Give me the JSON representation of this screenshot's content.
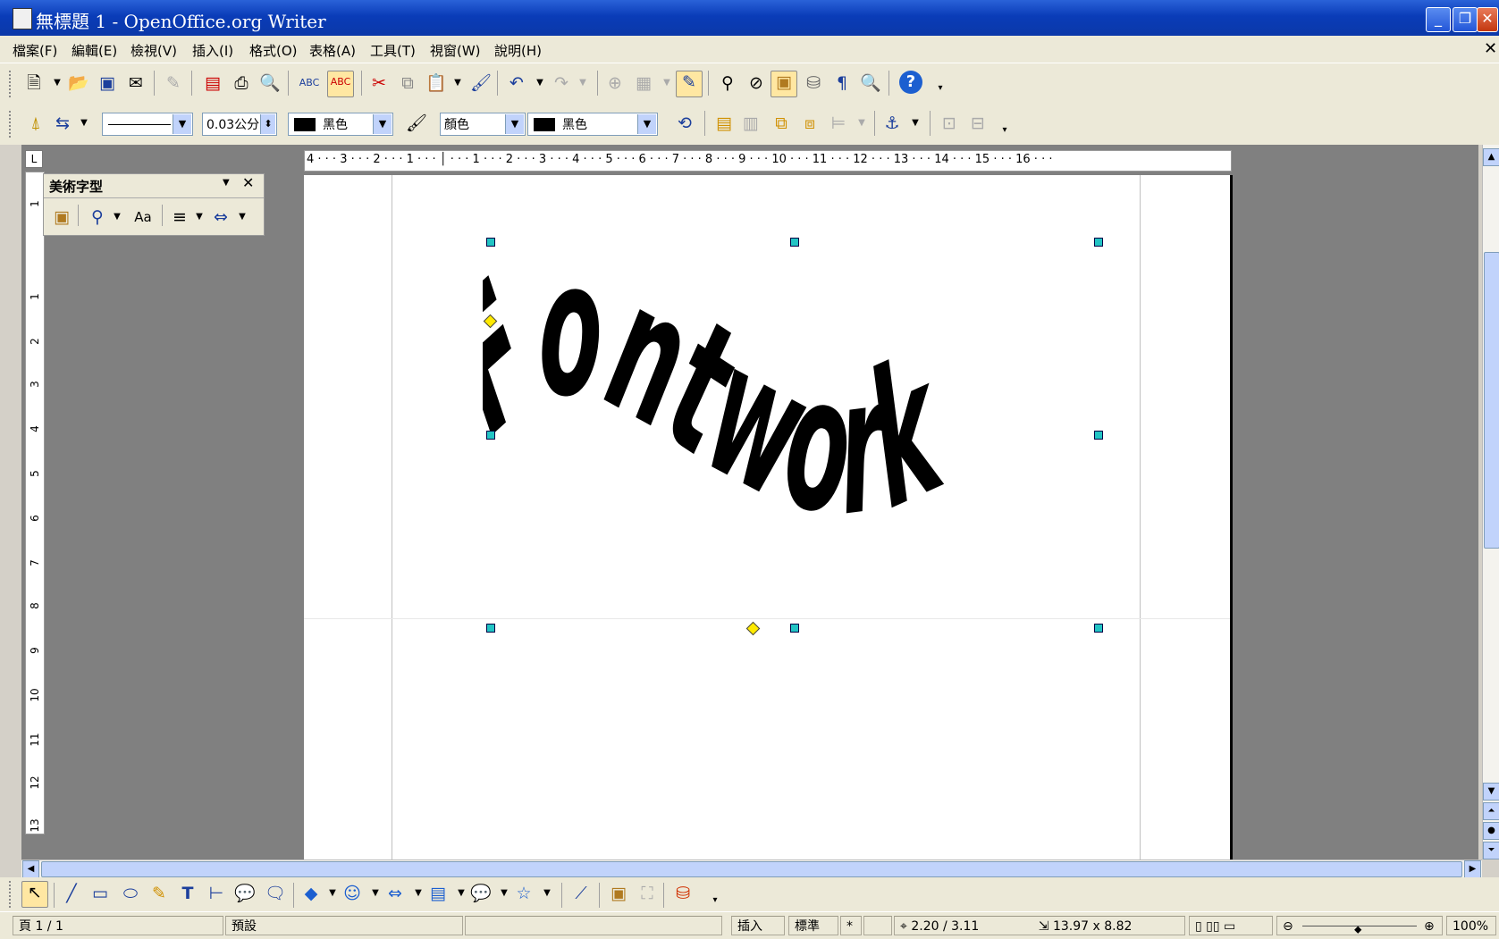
{
  "window": {
    "title": "無標題 1 - OpenOffice.org Writer",
    "minimize_label": "_",
    "restore_label": "❐",
    "close_label": "✕"
  },
  "menu": {
    "items": [
      "檔案(F)",
      "編輯(E)",
      "檢視(V)",
      "插入(I)",
      "格式(O)",
      "表格(A)",
      "工具(T)",
      "視窗(W)",
      "說明(H)"
    ],
    "doc_close": "✕"
  },
  "toolbar2": {
    "line_width": "0.03公分",
    "line_color": "黑色",
    "area_style": "顏色",
    "fill_color": "黑色"
  },
  "fontwork_toolbar": {
    "title": "美術字型",
    "same_height_label": "Aa"
  },
  "ruler": {
    "horizontal": "4 · · · 3 · · · 2 · · · 1 · · · │ · · · 1 · · · 2 · · · 3 · · · 4 · · · 5 · · · 6 · · · 7 · · · 8 · · · 9 · · · 10 · · · 11 · · · 12 · · · 13 · · · 14 · · · 15 · · · 16 · · ·",
    "vertical": [
      "1",
      "1",
      "2",
      "3",
      "4",
      "5",
      "6",
      "7",
      "8",
      "9",
      "10",
      "11",
      "12",
      "13"
    ],
    "corner": "L"
  },
  "document": {
    "fontwork_text": "Fontwork",
    "fill_color": "#000000"
  },
  "statusbar": {
    "page": "頁 1 / 1",
    "style": "預設",
    "insert_mode": "插入",
    "selection_mode": "標準",
    "modified": "*",
    "position": "2.20 / 3.11",
    "size": "13.97 x 8.82",
    "zoom": "100%"
  },
  "colors": {
    "titlebar": "#0a3cb8",
    "chrome": "#ece9d8",
    "handle": "#22c4c4",
    "adjust_handle": "#ffea00"
  }
}
